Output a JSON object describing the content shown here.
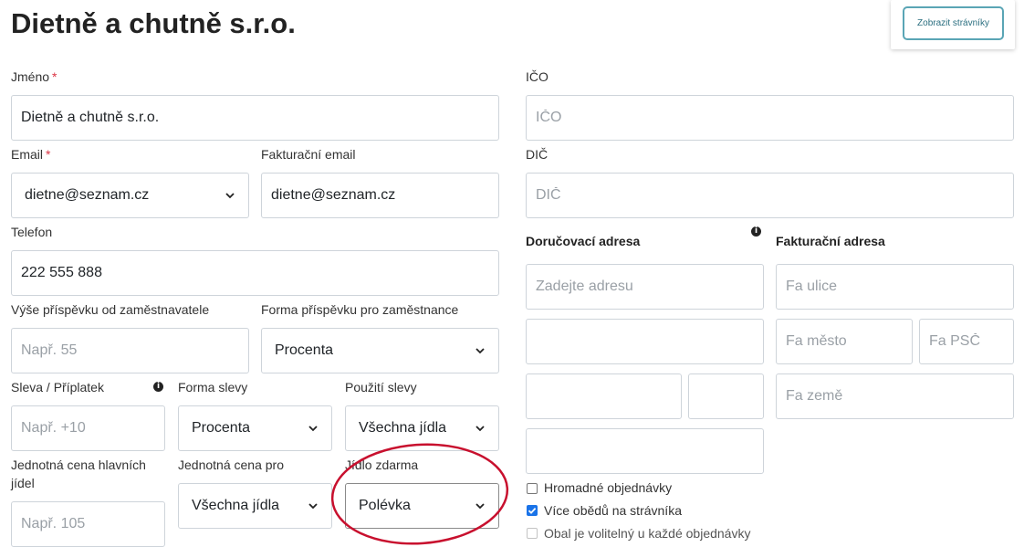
{
  "page": {
    "title": "Dietně a chutně s.r.o."
  },
  "header": {
    "view_diners_button": "Zobrazit strávníky"
  },
  "form": {
    "name": {
      "label": "Jméno",
      "required_mark": "*",
      "value": "Dietně a chutně s.r.o."
    },
    "ico": {
      "label": "IČO",
      "placeholder": "IČO"
    },
    "email": {
      "label": "Email",
      "required_mark": "*",
      "value": "dietne@seznam.cz"
    },
    "billing_email": {
      "label": "Fakturační email",
      "value": "dietne@seznam.cz"
    },
    "dic": {
      "label": "DIČ",
      "placeholder": "DIČ"
    },
    "phone": {
      "label": "Telefon",
      "value": "222 555 888"
    },
    "employer_contribution": {
      "label": "Výše příspěvku od zaměstnavatele",
      "placeholder": "Např. 55"
    },
    "contribution_form": {
      "label": "Forma příspěvku pro zaměstnance",
      "value": "Procenta"
    },
    "discount": {
      "label": "Sleva / Příplatek",
      "placeholder": "Např. +10"
    },
    "discount_form": {
      "label": "Forma slevy",
      "value": "Procenta"
    },
    "discount_usage": {
      "label": "Použití slevy",
      "value": "Všechna jídla"
    },
    "unit_price_main": {
      "label": "Jednotná cena hlavních jídel",
      "placeholder": "Např. 105"
    },
    "unit_price_for": {
      "label": "Jednotná cena pro",
      "value": "Všechna jídla"
    },
    "free_meal": {
      "label": "Jídlo zdarma",
      "value": "Polévka"
    }
  },
  "delivery": {
    "heading": "Doručovací adresa",
    "address_placeholder": "Zadejte adresu"
  },
  "billing": {
    "heading": "Fakturační adresa",
    "street_placeholder": "Fa ulice",
    "city_placeholder": "Fa město",
    "zip_placeholder": "Fa PSČ",
    "country_placeholder": "Fa země"
  },
  "checkboxes": [
    {
      "label": "Hromadné objednávky",
      "checked": false
    },
    {
      "label": "Více obědů na strávníka",
      "checked": true
    },
    {
      "label": "Obal je volitelný u každé objednávky",
      "checked": false
    }
  ],
  "annotation": {
    "color": "#c8102e"
  },
  "colors": {
    "accent": "#5aa5b5",
    "required": "#dc3545"
  }
}
